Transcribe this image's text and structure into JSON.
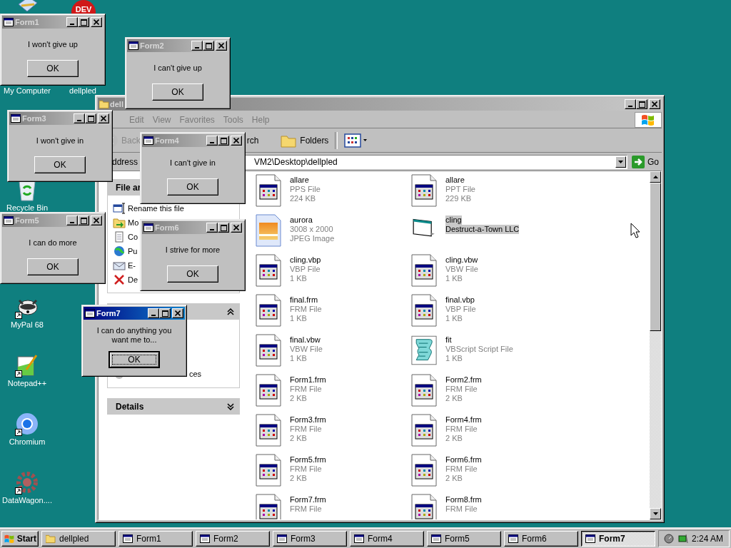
{
  "desktop_partial_icon": {
    "badge": "DEV"
  },
  "desktop_icons": [
    {
      "label": "My Computer"
    },
    {
      "label": "dellpled"
    },
    {
      "label": "Recycle Bin",
      "shortcut": false
    },
    {
      "label": "MyPal 68",
      "shortcut": true
    },
    {
      "label": "Notepad++",
      "shortcut": true
    },
    {
      "label": "Chromium",
      "shortcut": true
    },
    {
      "label": "DataWagon....",
      "shortcut": true
    }
  ],
  "explorer": {
    "title": "dell",
    "menu": [
      "Edit",
      "View",
      "Favorites",
      "Tools",
      "Help"
    ],
    "toolbar": {
      "back": {
        "label": "Back",
        "disabled": true
      },
      "search": "rch",
      "folders": "Folders"
    },
    "address": {
      "label": "ddress",
      "value": "VM2\\Desktop\\dellpled",
      "go": "Go"
    },
    "task_panels": [
      {
        "title": "File ar",
        "expanded": true,
        "items": [
          "Rename this file",
          "Mo",
          "Co",
          "Pu",
          "E-",
          "De"
        ]
      },
      {
        "expanded": true,
        "items": [
          "ces"
        ]
      },
      {
        "title": "Details",
        "expanded": false
      }
    ],
    "files": [
      {
        "name": "allare",
        "type": "PPS File",
        "size": "224 KB",
        "kind": "document",
        "selected": false
      },
      {
        "name": "allare",
        "type": "PPT File",
        "size": "229 KB",
        "kind": "document",
        "selected": false
      },
      {
        "name": "aurora",
        "type": "3008 x 2000",
        "size": "JPEG Image",
        "kind": "image",
        "selected": false
      },
      {
        "name": "cling",
        "type": "Destruct-a-Town LLC",
        "kind": "application",
        "selected": true
      },
      {
        "name": "cling.vbp",
        "type": "VBP File",
        "size": "1 KB",
        "kind": "document",
        "selected": false
      },
      {
        "name": "cling.vbw",
        "type": "VBW File",
        "size": "1 KB",
        "kind": "document",
        "selected": false
      },
      {
        "name": "final.frm",
        "type": "FRM File",
        "size": "1 KB",
        "kind": "document",
        "selected": false
      },
      {
        "name": "final.vbp",
        "type": "VBP File",
        "size": "1 KB",
        "kind": "document",
        "selected": false
      },
      {
        "name": "final.vbw",
        "type": "VBW File",
        "size": "1 KB",
        "kind": "document",
        "selected": false
      },
      {
        "name": "fit",
        "type": "VBScript Script File",
        "size": "1 KB",
        "kind": "script",
        "selected": false
      },
      {
        "name": "Form1.frm",
        "type": "FRM File",
        "size": "2 KB",
        "kind": "document",
        "selected": false
      },
      {
        "name": "Form2.frm",
        "type": "FRM File",
        "size": "2 KB",
        "kind": "document",
        "selected": false
      },
      {
        "name": "Form3.frm",
        "type": "FRM File",
        "size": "2 KB",
        "kind": "document",
        "selected": false
      },
      {
        "name": "Form4.frm",
        "type": "FRM File",
        "size": "2 KB",
        "kind": "document",
        "selected": false
      },
      {
        "name": "Form5.frm",
        "type": "FRM File",
        "size": "2 KB",
        "kind": "document",
        "selected": false
      },
      {
        "name": "Form6.frm",
        "type": "FRM File",
        "size": "2 KB",
        "kind": "document",
        "selected": false
      },
      {
        "name": "Form7.frm",
        "type": "FRM File",
        "kind": "document",
        "selected": false
      },
      {
        "name": "Form8.frm",
        "type": "FRM File",
        "kind": "document",
        "selected": false
      }
    ]
  },
  "forms": [
    {
      "title": "Form1",
      "message": "I won't give up",
      "button": "OK",
      "active": false,
      "focused": false
    },
    {
      "title": "Form2",
      "message": "I can't give up",
      "button": "OK",
      "active": false,
      "focused": false
    },
    {
      "title": "Form3",
      "message": "I won't give in",
      "button": "OK",
      "active": false,
      "focused": false
    },
    {
      "title": "Form4",
      "message": "I can't give in",
      "button": "OK",
      "active": false,
      "focused": false
    },
    {
      "title": "Form5",
      "message": "I can do more",
      "button": "OK",
      "active": false,
      "focused": false
    },
    {
      "title": "Form6",
      "message": "I strive for more",
      "button": "OK",
      "active": false,
      "focused": false
    },
    {
      "title": "Form7",
      "message": "I can do anything you want me to...",
      "button": "OK",
      "active": true,
      "focused": true
    }
  ],
  "taskbar": {
    "start": "Start",
    "buttons": [
      {
        "label": "dellpled",
        "kind": "folder",
        "selected": false
      },
      {
        "label": "Form1",
        "kind": "form",
        "selected": false
      },
      {
        "label": "Form2",
        "kind": "form",
        "selected": false
      },
      {
        "label": "Form3",
        "kind": "form",
        "selected": false
      },
      {
        "label": "Form4",
        "kind": "form",
        "selected": false
      },
      {
        "label": "Form5",
        "kind": "form",
        "selected": false
      },
      {
        "label": "Form6",
        "kind": "form",
        "selected": false
      },
      {
        "label": "Form7",
        "kind": "form",
        "selected": true
      }
    ],
    "clock": "2:24 AM"
  }
}
